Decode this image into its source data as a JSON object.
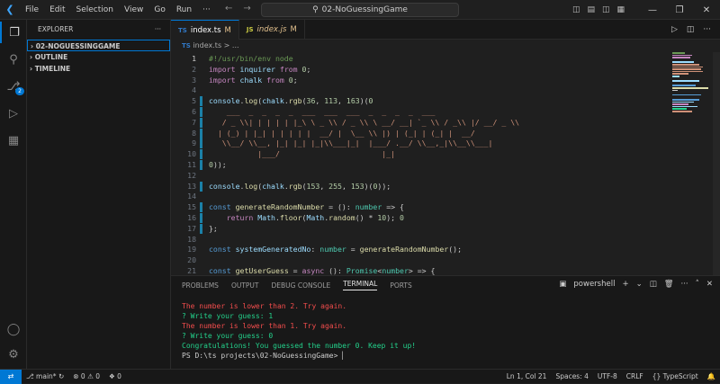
{
  "menu": [
    "File",
    "Edit",
    "Selection",
    "View",
    "Go",
    "Run",
    "···"
  ],
  "search": {
    "text": "02-NoGuessingGame"
  },
  "activity": {
    "scm_badge": "2"
  },
  "sidebar": {
    "title": "EXPLORER",
    "sections": [
      "02-NOGUESSINGGAME",
      "OUTLINE",
      "TIMELINE"
    ]
  },
  "tabs": [
    {
      "icon": "TS",
      "name": "index.ts",
      "status": "M"
    },
    {
      "icon": "JS",
      "name": "index.js",
      "status": "M"
    }
  ],
  "breadcrumb": {
    "icon": "TS",
    "path": "index.ts > ..."
  },
  "code": [
    {
      "n": "1",
      "t": "#!/usr/bin/env node"
    },
    {
      "n": "2",
      "t": "import inquirer from \"inquirer\";"
    },
    {
      "n": "3",
      "t": "import chalk from \"chalk\";"
    },
    {
      "n": "4",
      "t": ""
    },
    {
      "n": "5",
      "t": "console.log(chalk.rgb(36, 113, 163)(`"
    },
    {
      "n": "6",
      "t": "    ___  _  _  _  _  ___  ___  ___  _  _  _  _  ___"
    },
    {
      "n": "7",
      "t": "   / _ \\\\| | | | | |_\\ \\ _ \\\\ / _ \\\\ \\ __/ __| `_ \\\\ / _\\\\ |/ __/ _ \\\\"
    },
    {
      "n": "8",
      "t": "  | (_) | |_| | | | | |  __/ |  \\__ \\\\ |) | (_| | (_| |  __/"
    },
    {
      "n": "9",
      "t": "   \\\\__/ \\\\__, |_| |_| |_|\\\\___|_|  |___/ .__/ \\\\__,_|\\\\__\\\\___|"
    },
    {
      "n": "10",
      "t": "           |___/                       |_|"
    },
    {
      "n": "11",
      "t": "`));"
    },
    {
      "n": "12",
      "t": ""
    },
    {
      "n": "13",
      "t": "console.log(chalk.rgb(153, 255, 153)(\"START GAME\"));"
    },
    {
      "n": "14",
      "t": ""
    },
    {
      "n": "15",
      "t": "const generateRandomNumber = (): number => {"
    },
    {
      "n": "16",
      "t": "    return Math.floor(Math.random() * 10); // Generates a random number between 0 and 9"
    },
    {
      "n": "17",
      "t": "};"
    },
    {
      "n": "18",
      "t": ""
    },
    {
      "n": "19",
      "t": "const systemGeneratedNo: number = generateRandomNumber();"
    },
    {
      "n": "20",
      "t": ""
    },
    {
      "n": "21",
      "t": "const getUserGuess = async (): Promise<number> => {"
    }
  ],
  "panel": {
    "tabs": [
      "PROBLEMS",
      "OUTPUT",
      "DEBUG CONSOLE",
      "TERMINAL",
      "PORTS"
    ],
    "shell": "powershell",
    "terminal": [
      {
        "t": "The number is lower than 2. Try again.",
        "c": "#f14c4c"
      },
      {
        "t": "? Write your guess: 1",
        "c": "#23d18b"
      },
      {
        "t": "The number is lower than 1. Try again.",
        "c": "#f14c4c"
      },
      {
        "t": "? Write your guess: 0",
        "c": "#23d18b"
      },
      {
        "t": "Congratulations! You guessed the number 0. Keep it up!",
        "c": "#23d18b"
      },
      {
        "t": "PS D:\\ts projects\\02-NoGuessingGame> ",
        "c": "#cccccc"
      }
    ]
  },
  "status": {
    "branch": "main*",
    "errors": "0",
    "warnings": "0",
    "ports": "0",
    "position": "Ln 1, Col 21",
    "spaces": "Spaces: 4",
    "encoding": "UTF-8",
    "eol": "CRLF",
    "language": "TypeScript"
  },
  "colors": {
    "accent": "#0078d4",
    "error": "#f14c4c",
    "success": "#23d18b",
    "modified": "#e2c08d"
  }
}
